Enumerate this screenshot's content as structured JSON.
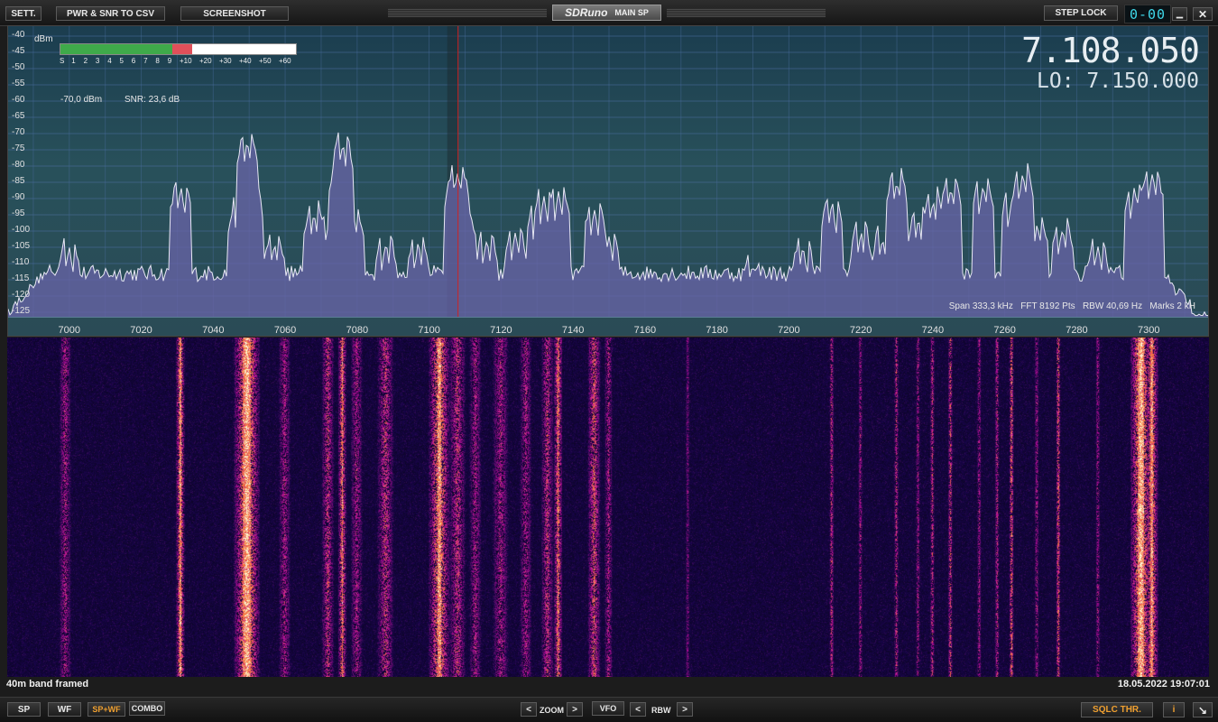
{
  "toolbar": {
    "sett": "SETT.",
    "pwr_snr": "PWR & SNR TO CSV",
    "screenshot": "SCREENSHOT",
    "app_logo": "SDRuno",
    "window_name": "MAIN SP",
    "step_lock": "STEP LOCK",
    "step_display": "0-00",
    "minimize": "▁",
    "close": "✕"
  },
  "spectrum": {
    "unit": "dBm",
    "smeter_labels": [
      "S",
      "1",
      "2",
      "3",
      "4",
      "5",
      "6",
      "7",
      "8",
      "9",
      "+10",
      "+20",
      "+30",
      "+40",
      "+50",
      "+60"
    ],
    "smeter_level": 0.56,
    "power_text": "-70,0 dBm",
    "snr_text": "SNR: 23,6 dB",
    "frequency": "7.108.050",
    "lo_label": "LO:",
    "lo_frequency": "7.150.000",
    "info": "Span 333,3 kHz   FFT 8192 Pts   RBW 40,69 Hz   Marks 2 kH",
    "y_labels": [
      "-40",
      "-45",
      "-50",
      "-55",
      "-60",
      "-65",
      "-70",
      "-75",
      "-80",
      "-85",
      "-90",
      "-95",
      "-100",
      "-105",
      "-110",
      "-115",
      "-120",
      "-125"
    ],
    "x_labels": [
      "7000",
      "7020",
      "7040",
      "7060",
      "7080",
      "7100",
      "7120",
      "7140",
      "7160",
      "7180",
      "7200",
      "7220",
      "7240",
      "7260",
      "7280",
      "7300"
    ],
    "colors": {
      "fill": "#6a64a8",
      "trace": "#e8e8f4",
      "marker": "#d02020",
      "grid": "#4a6ea0"
    }
  },
  "waterfall": {
    "caption": "40m band framed",
    "timestamp": "18.05.2022 19:07:01"
  },
  "bottom": {
    "sp": "SP",
    "wf": "WF",
    "spwf": "SP+WF",
    "combo": "COMBO",
    "zoom": "ZOOM",
    "vfo": "VFO",
    "rbw": "RBW",
    "left": "<",
    "right": ">",
    "sqlc": "SQLC THR.",
    "info": "i",
    "resize": "↘"
  }
}
